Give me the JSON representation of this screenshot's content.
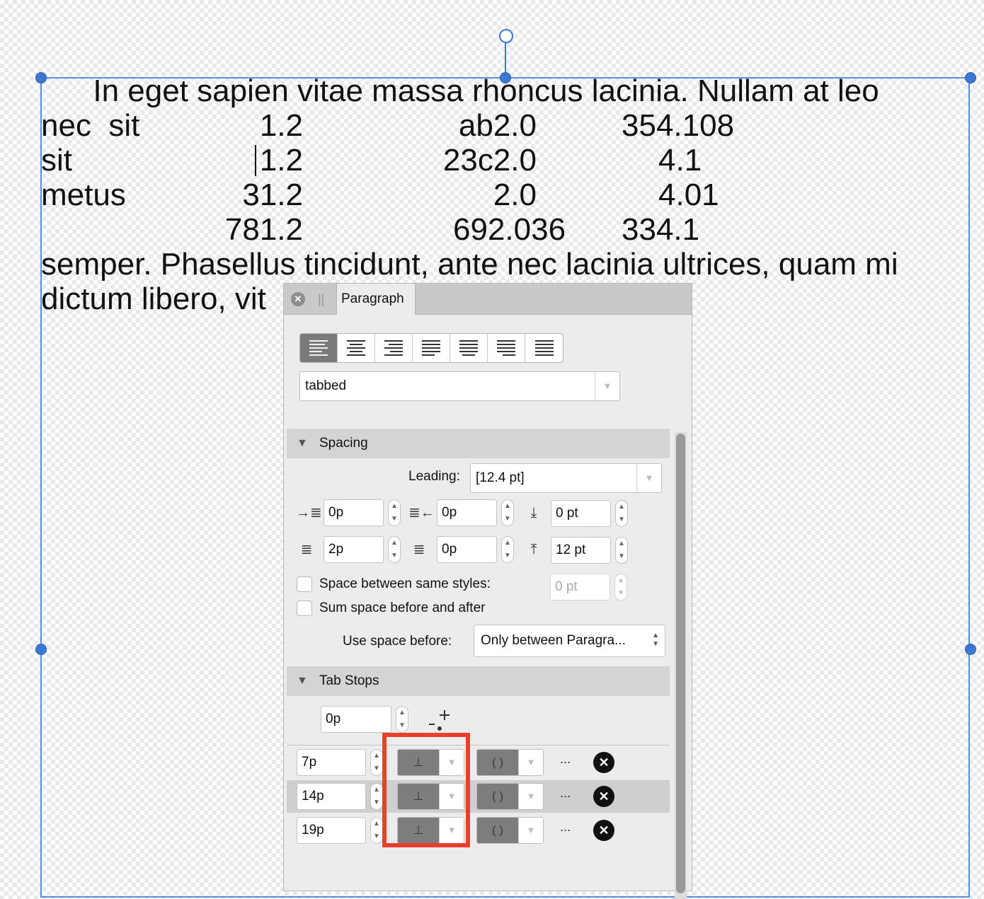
{
  "document": {
    "line1": "      In eget sapien vitae massa rhoncus lacinia. Nullam at leo",
    "rows": [
      [
        "nec  sit",
        "1.2",
        "ab2.0",
        "354.108"
      ],
      [
        "sit",
        "1.2",
        "23c2.0",
        "4.1"
      ],
      [
        "metus",
        "31.2",
        "2.0",
        "4.01"
      ],
      [
        "",
        "781.2",
        "692.036",
        "334.1"
      ]
    ],
    "line_after1": "semper. Phasellus tincidunt, ante nec lacinia ultrices, quam mi",
    "line_after2": "dictum libero, vit"
  },
  "panel": {
    "tab_label": "Paragraph",
    "style_value": "tabbed",
    "spacing": {
      "header": "Spacing",
      "leading_label": "Leading:",
      "leading_value": "[12.4 pt]",
      "left_indent": "0p",
      "right_indent": "0p",
      "space_before": "0 pt",
      "first_line_indent": "2p",
      "last_line_indent": "0p",
      "space_after": "12 pt",
      "same_styles_label": "Space between same styles:",
      "same_styles_value": "0 pt",
      "sum_space_label": "Sum space before and after",
      "use_space_before_label": "Use space before:",
      "use_space_before_value": "Only between Paragra..."
    },
    "tab_stops": {
      "header": "Tab Stops",
      "default_value": "0p",
      "stops": [
        {
          "position": "7p",
          "align_symbol": "⊥",
          "leader_symbol": "( )",
          "more": "..."
        },
        {
          "position": "14p",
          "align_symbol": "⊥",
          "leader_symbol": "( )",
          "more": "..."
        },
        {
          "position": "19p",
          "align_symbol": "⊥",
          "leader_symbol": "( )",
          "more": "..."
        }
      ]
    }
  }
}
